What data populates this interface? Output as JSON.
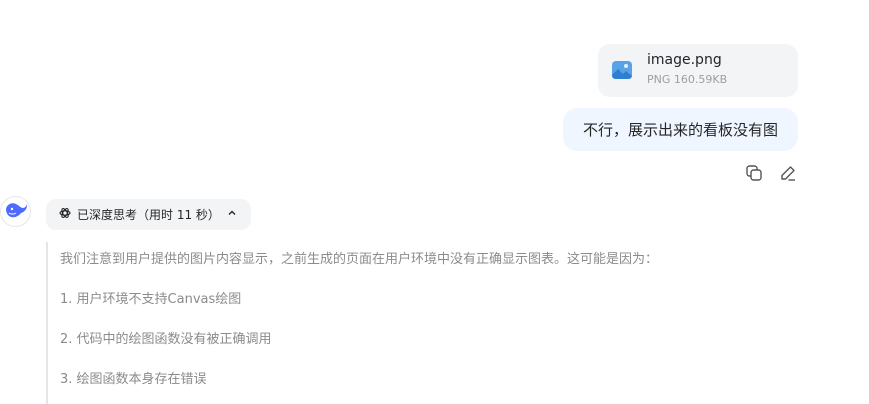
{
  "attachment": {
    "file_name": "image.png",
    "file_meta": "PNG 160.59KB",
    "icon": "image-file-icon"
  },
  "user_message": {
    "text": "不行，展示出来的看板没有图",
    "actions": [
      "copy-icon",
      "edit-icon"
    ]
  },
  "assistant": {
    "avatar": "deepseek-whale-icon",
    "think_label": "已深度思考（用时 11 秒）",
    "think_lines": [
      "我们注意到用户提供的图片内容显示，之前生成的页面在用户环境中没有正确显示图表。这可能是因为：",
      "1. 用户环境不支持Canvas绘图",
      "2. 代码中的绘图函数没有被正确调用",
      "3. 绘图函数本身存在错误"
    ]
  },
  "colors": {
    "user_bubble": "#eff6ff",
    "card_bg": "#f3f4f6",
    "accent": "#4d6bfe",
    "think_text": "#8b8b8b"
  }
}
